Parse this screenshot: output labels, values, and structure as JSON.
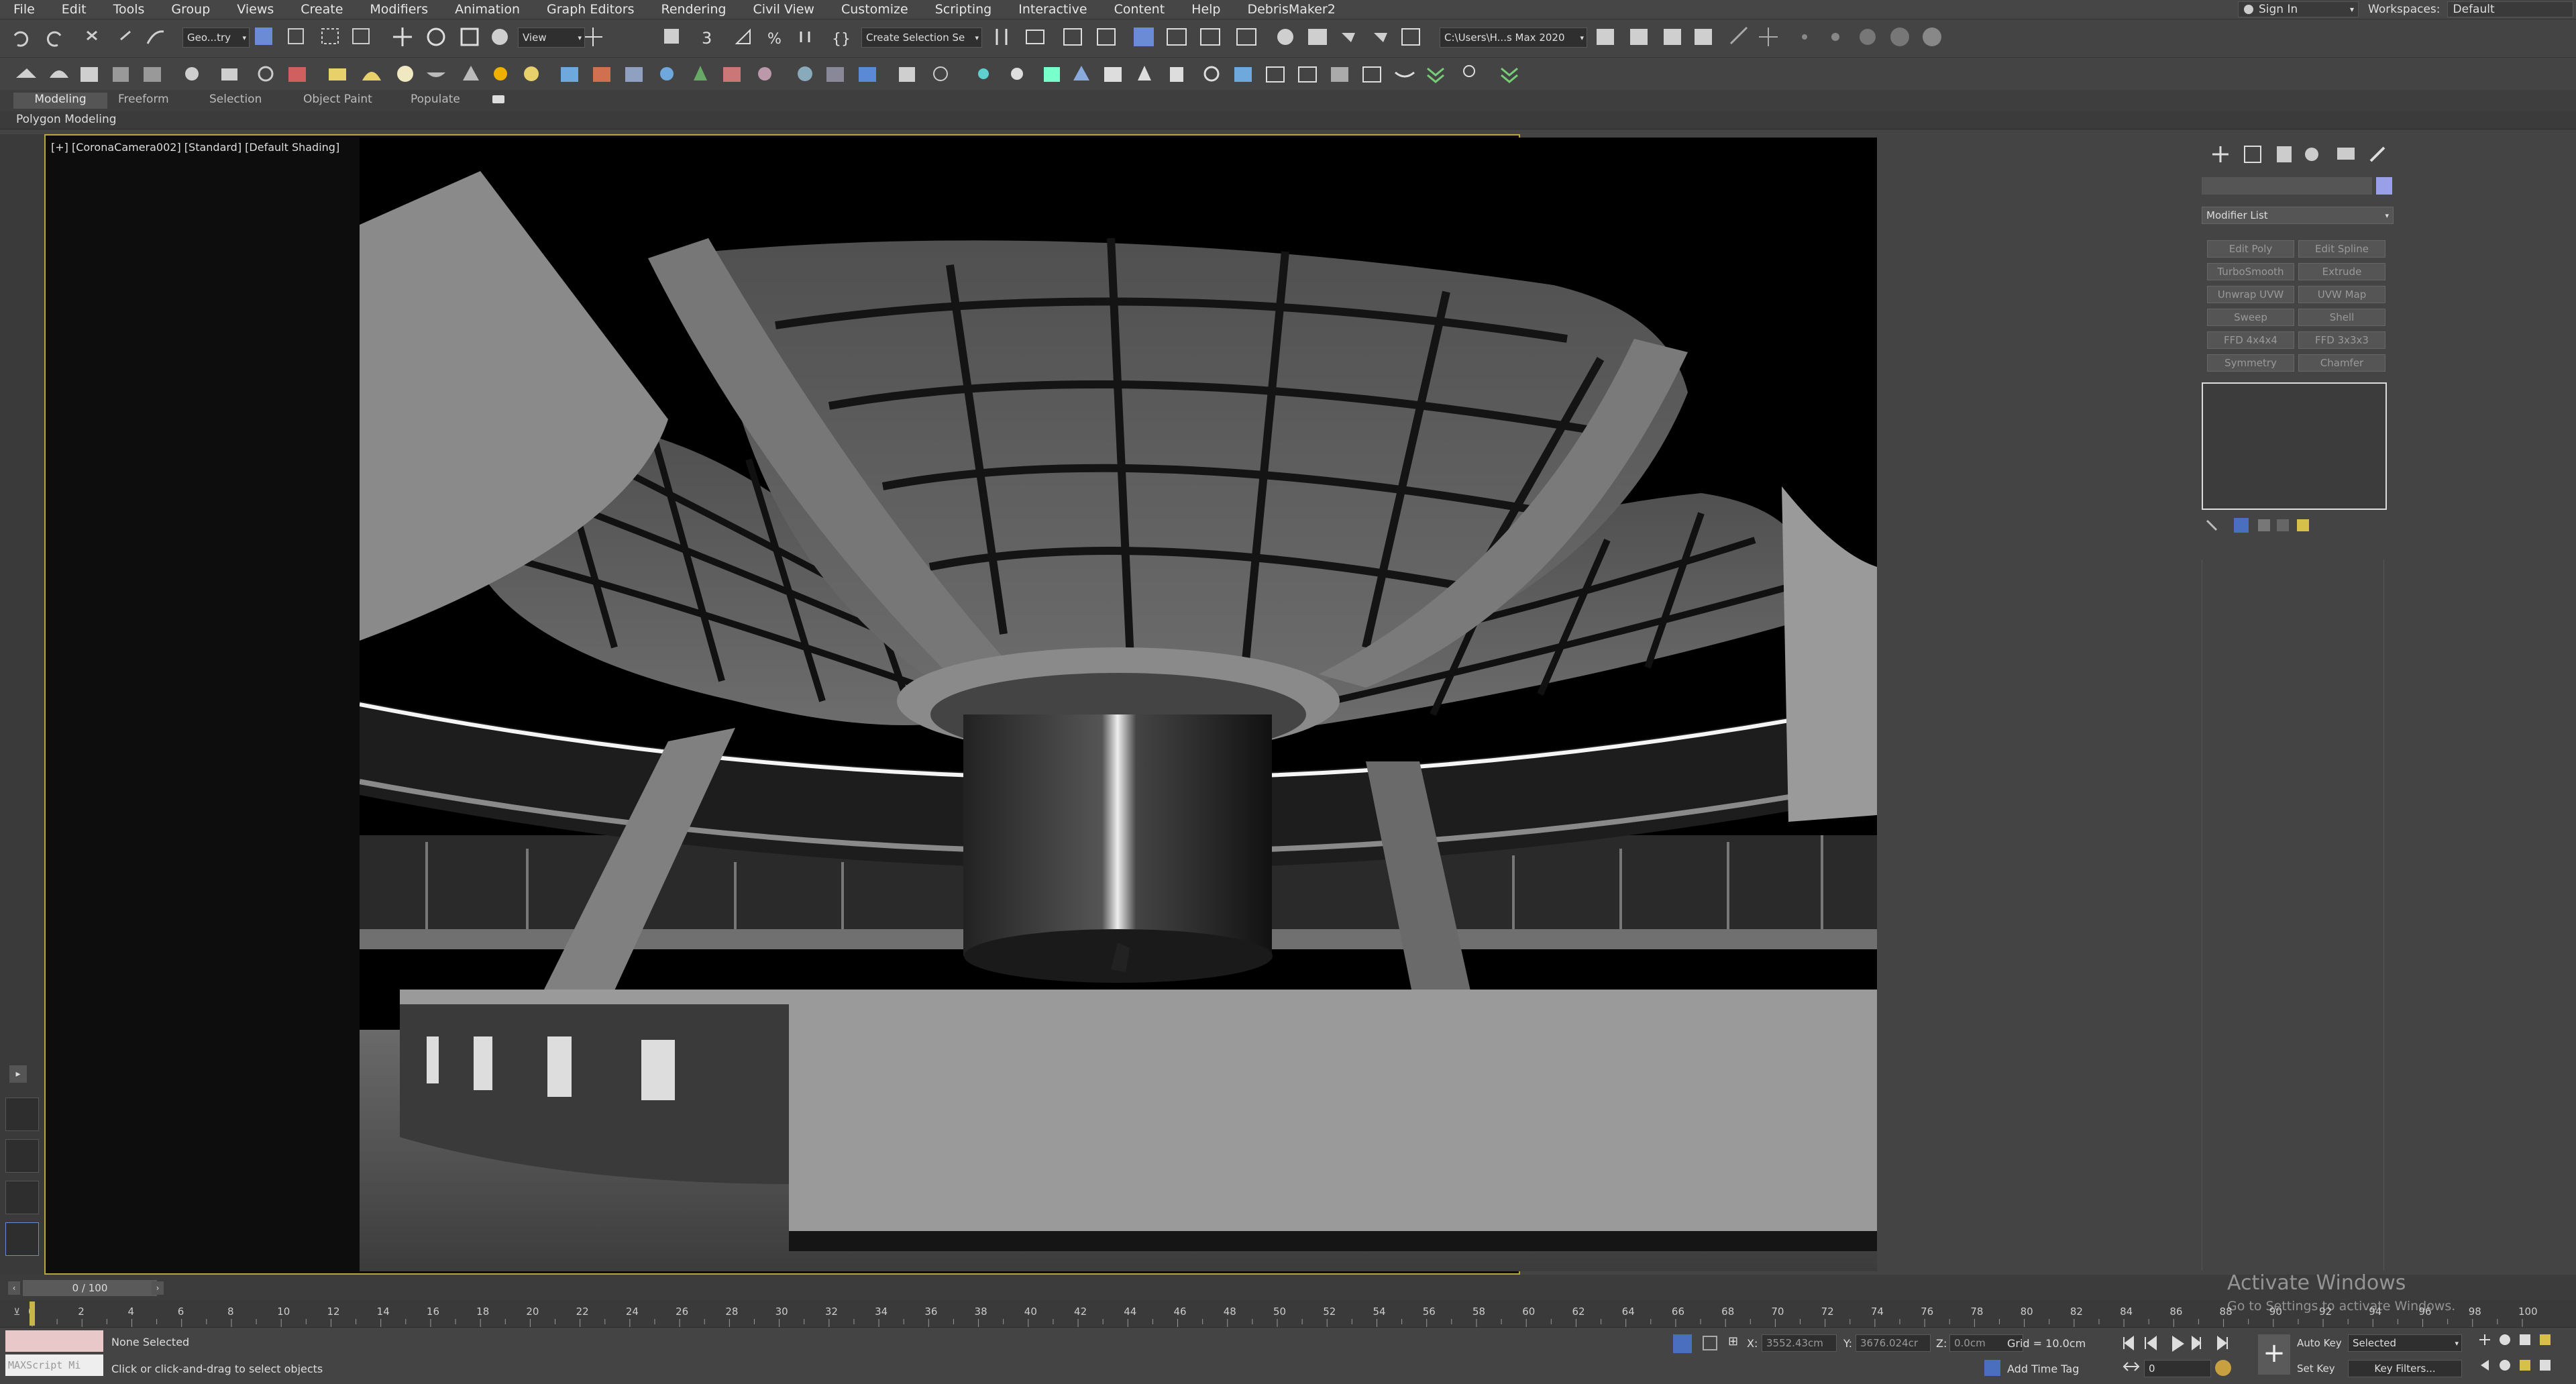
{
  "menu": [
    "File",
    "Edit",
    "Tools",
    "Group",
    "Views",
    "Create",
    "Modifiers",
    "Animation",
    "Graph Editors",
    "Rendering",
    "Civil View",
    "Customize",
    "Scripting",
    "Interactive",
    "Content",
    "Help",
    "DebrisMaker2"
  ],
  "signin": "Sign In",
  "workspaces": {
    "label": "Workspaces:",
    "value": "Default"
  },
  "toolbar": {
    "selection_filter": "Geo...try",
    "view_dropdown": "View",
    "selection_set": "Create Selection Se",
    "project_path": "C:\\Users\\H...s Max 2020"
  },
  "ribbon": {
    "tabs": [
      "Modeling",
      "Freeform",
      "Selection",
      "Object Paint",
      "Populate"
    ],
    "sub_label": "Polygon Modeling"
  },
  "viewport": {
    "label": "[+] [CoronaCamera002] [Standard] [Default Shading]"
  },
  "command_panel": {
    "modifier_list": "Modifier List",
    "buttons": [
      "Edit Poly",
      "Edit Spline",
      "TurboSmooth",
      "Extrude",
      "Unwrap UVW",
      "UVW Map",
      "Sweep",
      "Shell",
      "FFD 4x4x4",
      "FFD 3x3x3",
      "Symmetry",
      "Chamfer"
    ]
  },
  "timeline": {
    "frame": "0 / 100",
    "ticks": [
      0,
      2,
      4,
      6,
      8,
      10,
      12,
      14,
      16,
      18,
      20,
      22,
      24,
      26,
      28,
      30,
      32,
      34,
      36,
      38,
      40,
      42,
      44,
      46,
      48,
      50,
      52,
      54,
      56,
      58,
      60,
      62,
      64,
      66,
      68,
      70,
      72,
      74,
      76,
      78,
      80,
      82,
      84,
      86,
      88,
      90,
      92,
      94,
      96,
      98,
      100
    ]
  },
  "status": {
    "maxscript": "MAXScript Mi",
    "selected": "None Selected",
    "prompt": "Click or click-and-drag to select objects",
    "x_label": "X:",
    "x_value": "3552.43cm",
    "y_label": "Y:",
    "y_value": "3676.024cr",
    "z_label": "Z:",
    "z_value": "0.0cm",
    "grid": "Grid = 10.0cm",
    "add_time_tag": "Add Time Tag",
    "auto_key": "Auto Key",
    "auto_key_value": "Selected",
    "set_key": "Set Key",
    "key_filters": "Key Filters...",
    "frame_value": "0"
  },
  "watermark": {
    "title": "Activate Windows",
    "subtitle": "Go to Settings to activate Windows."
  },
  "colors": {
    "viewport_border": "#b8a640",
    "panel": "#444444",
    "selection_swatch": "#9aa0e8"
  }
}
